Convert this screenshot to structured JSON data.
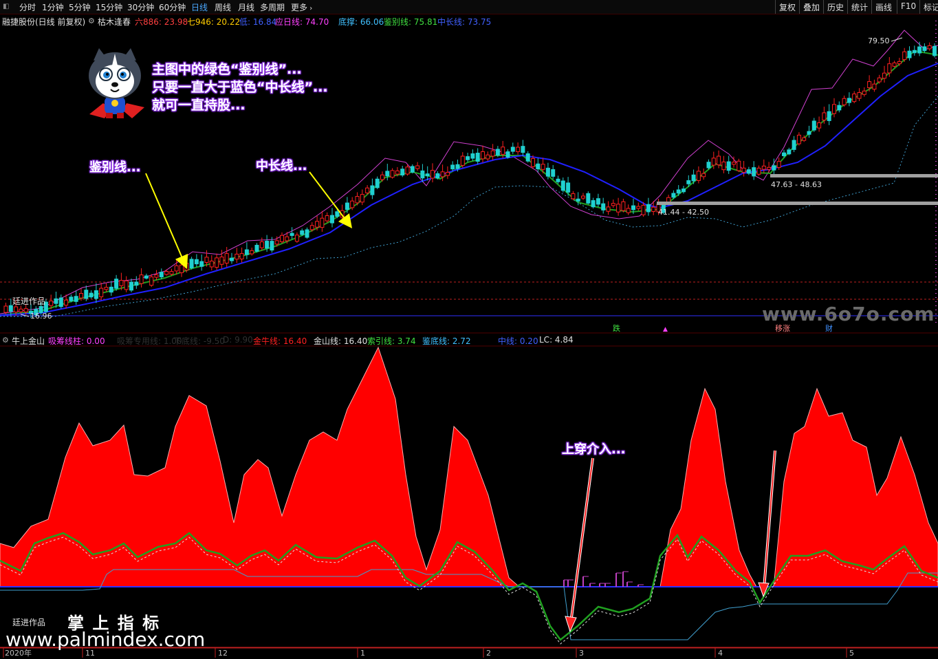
{
  "toolbar": {
    "periods": [
      "分时",
      "1分钟",
      "5分钟",
      "15分钟",
      "30分钟",
      "60分钟",
      "日线",
      "周线",
      "月线",
      "多周期",
      "更多"
    ],
    "active_period": "日线",
    "right_buttons": [
      "复权",
      "叠加",
      "历史",
      "统计",
      "画线",
      "F10",
      "标记"
    ]
  },
  "main_info": {
    "stock_label": "融捷股份(日线 前复权)",
    "indicator_name": "枯木逢春",
    "values": [
      {
        "label": "六886:",
        "value": "23.98",
        "color": "#ff4040"
      },
      {
        "label": "七946:",
        "value": "20.22",
        "color": "#ffcc00"
      },
      {
        "label": "低:",
        "value": "16.84",
        "color": "#4060ff"
      },
      {
        "label": "应日线:",
        "value": "74.70",
        "color": "#ff40ff"
      },
      {
        "label": "底撑:",
        "value": "66.06",
        "color": "#40c0ff"
      },
      {
        "label": "鉴别线:",
        "value": "75.81",
        "color": "#40e040"
      },
      {
        "label": "中长线:",
        "value": "73.75",
        "color": "#4060ff"
      }
    ]
  },
  "price_labels": {
    "high": "79.50",
    "zone1": "47.63 - 48.63",
    "zone2": "41.44 - 42.50",
    "low": "16.96"
  },
  "markers": {
    "m1": "跌",
    "m2": "移涨",
    "m3": "财"
  },
  "callouts": {
    "main_line1": "主图中的绿色“鉴别线”...",
    "main_line2": "只要一直大于蓝色“中长线”...",
    "main_line3": "就可一直持股...",
    "jianbie": "鉴别线...",
    "zhongchang": "中长线...",
    "shangchuan": "上穿介入..."
  },
  "author_label": "廷进作品",
  "sub_info": {
    "indicator_name": "牛上金山",
    "values": [
      {
        "label": "吸筹线柱:",
        "value": "0.00",
        "color": "#ff40ff"
      },
      {
        "label": "吸筹专用线:",
        "value": "1.00",
        "color": "#303030"
      },
      {
        "label": "下底线:",
        "value": "-9.50",
        "color": "#303030"
      },
      {
        "label": "D:",
        "value": "9.90",
        "color": "#303030"
      },
      {
        "label": "金牛线:",
        "value": "16.40",
        "color": "#ff2020"
      },
      {
        "label": "金山线:",
        "value": "16.40",
        "color": "#e0e0e0"
      },
      {
        "label": "索引线:",
        "value": "3.74",
        "color": "#40e040"
      },
      {
        "label": "鉴底线:",
        "value": "2.72",
        "color": "#40c0ff"
      },
      {
        "label": "中线:",
        "value": "0.20",
        "color": "#4060ff"
      },
      {
        "label": "LC:",
        "value": "4.84",
        "color": "#e0e0e0"
      }
    ]
  },
  "x_axis": {
    "labels": [
      "2020年",
      "11",
      "12",
      "1",
      "2",
      "3",
      "4",
      "5"
    ]
  },
  "watermarks": {
    "site1": "www.6o7o.com",
    "brand": "掌 上 指 标",
    "site2": "www.palmindex.com"
  },
  "colors": {
    "background": "#000000",
    "candle_up": "#ff2020",
    "candle_down": "#20d0d0",
    "jianbie_line": "#20a020",
    "zhongchang_line": "#2020ff",
    "support_dotted": "#40a0d0",
    "callout_glow": "#8a2be2",
    "area_fill": "#ff0000"
  }
}
